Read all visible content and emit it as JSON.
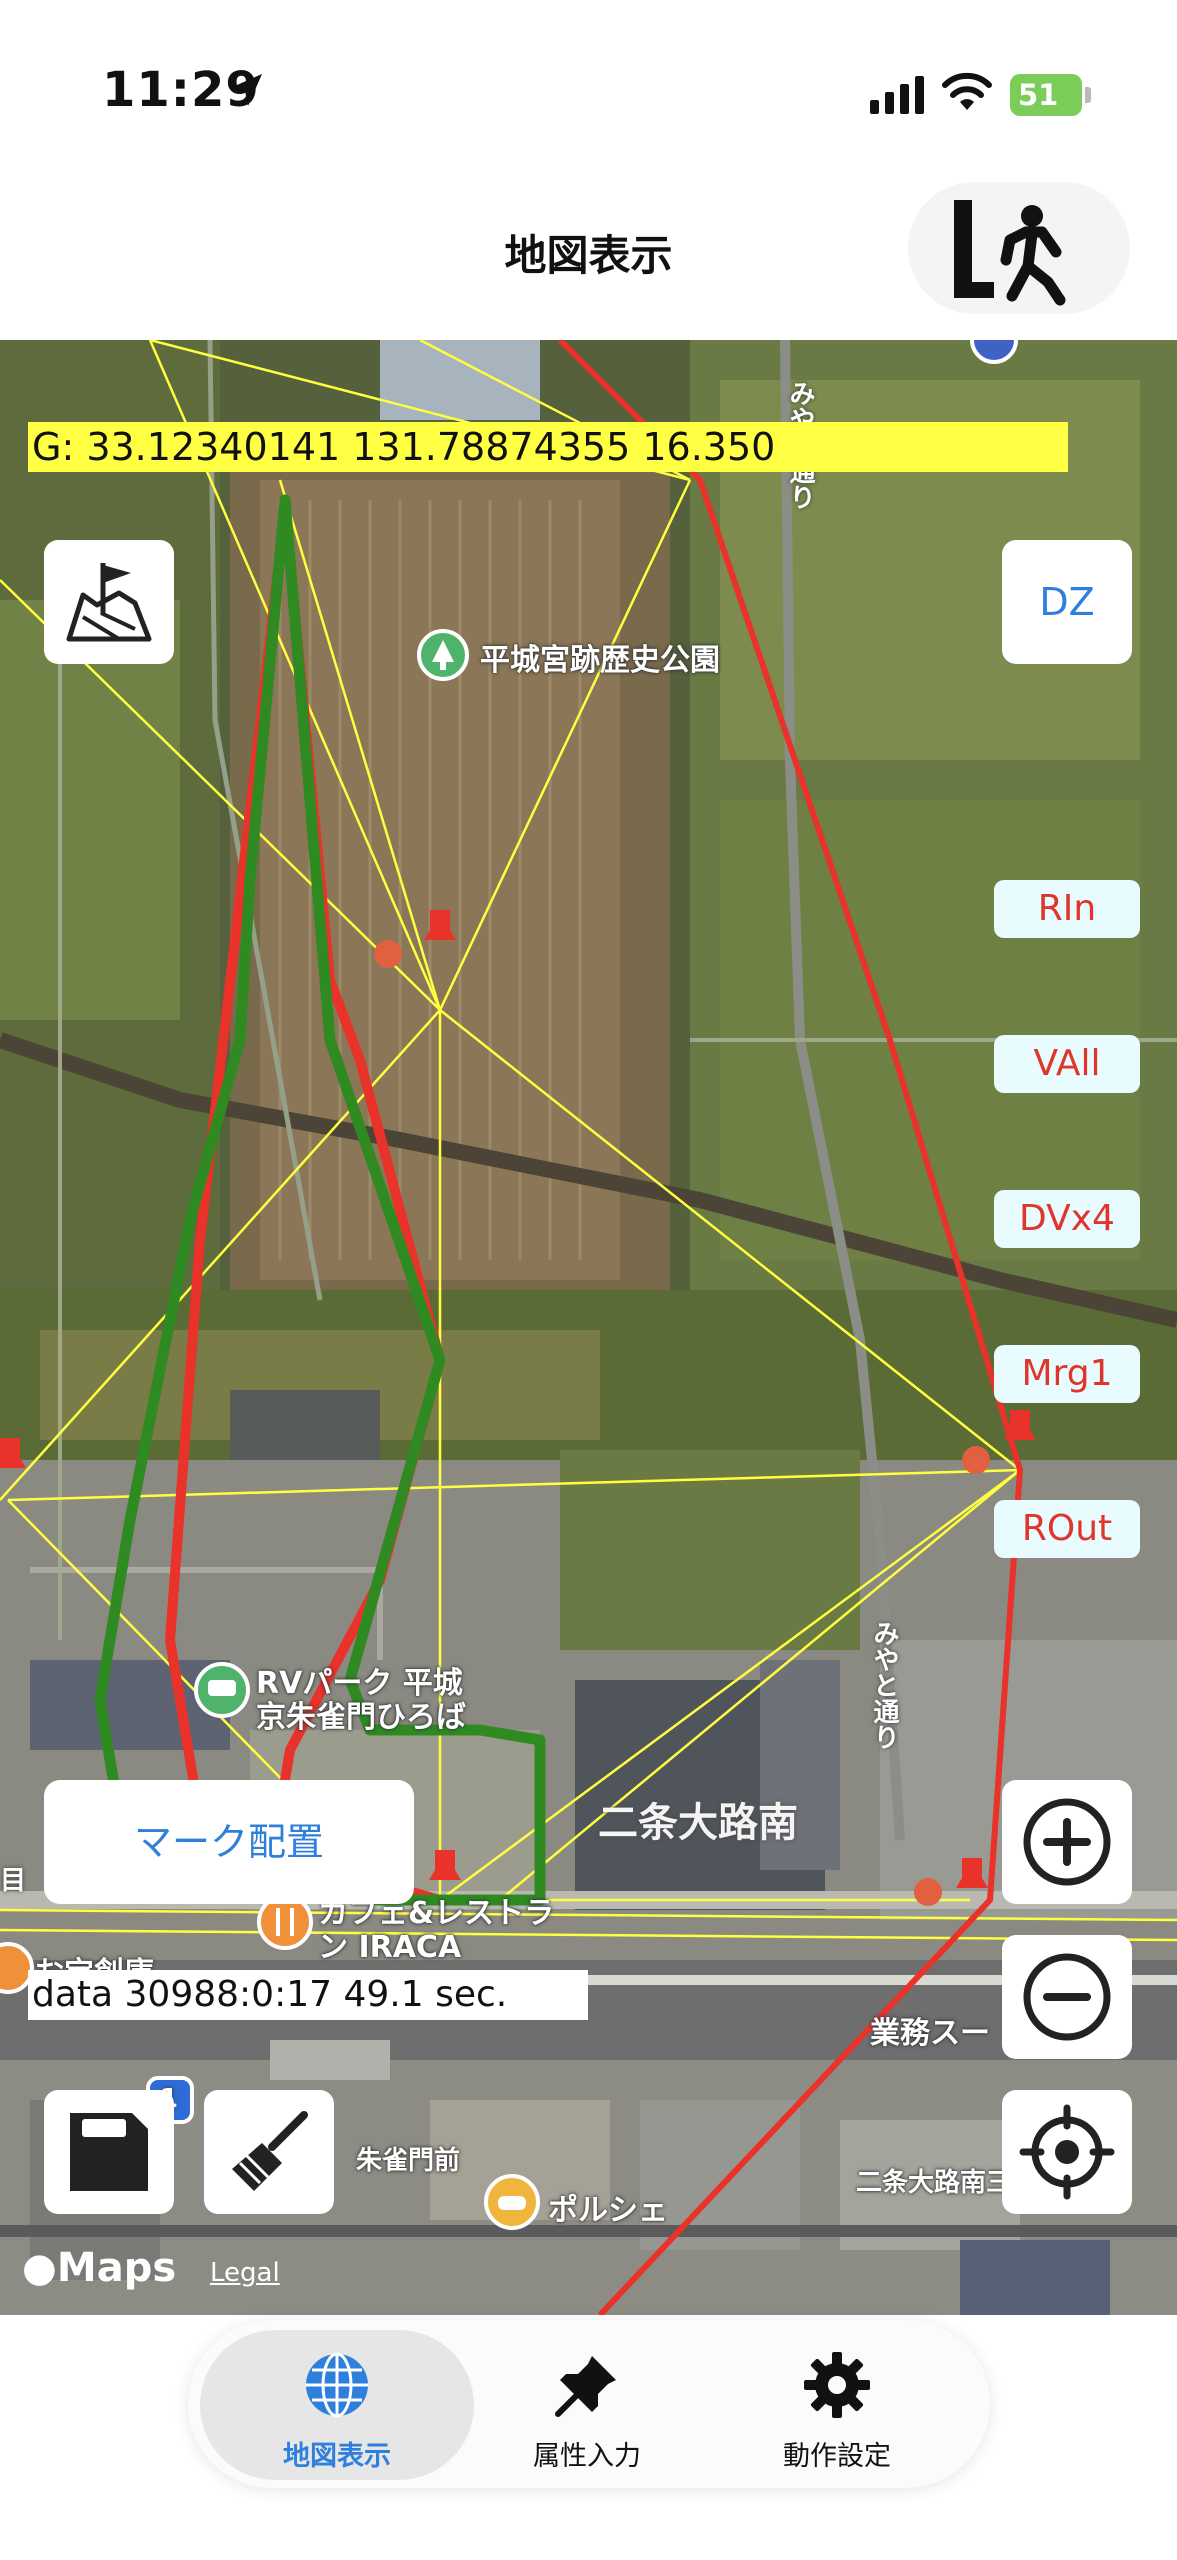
{
  "status_bar": {
    "time": "11:29",
    "battery": "51"
  },
  "nav": {
    "title": "地図表示"
  },
  "map": {
    "coordinate_readout": "G: 33.12340141 131.78874355 16.350",
    "data_readout": "data 30988:0:17 49.1 sec.",
    "side_buttons": {
      "dz": "DZ",
      "rin": "RIn",
      "vall": "VAll",
      "dvx4": "DVx4",
      "mrg1": "Mrg1",
      "rout": "ROut"
    },
    "mark_button": "マーク配置",
    "poi": {
      "park": "平城宮跡歴史公園",
      "rv_park_1": "RVパーク 平城",
      "rv_park_2": "京朱雀門ひろば",
      "cafe_1": "カフェ&レストラ",
      "cafe_2": "ン IRACA",
      "suzakumon": "朱雀門前",
      "porsche": "ポルシェ",
      "nijo_south": "二条大路南",
      "nijo_south_short": "二条大路南三",
      "business": "業務スー",
      "shop": "お宝創庫",
      "road_1": "みやと通り",
      "road_2": "みやと通り",
      "edge": "目",
      "route_num": "1"
    },
    "maps_logo": "Maps",
    "legal": "Legal",
    "colors": {
      "track_red": "#e8322a",
      "track_green": "#2f8a22",
      "grid_yellow": "#ffff40"
    }
  },
  "tabs": [
    {
      "label": "地図表示",
      "icon": "globe-icon",
      "active": true
    },
    {
      "label": "属性入力",
      "icon": "pushpin-icon",
      "active": false
    },
    {
      "label": "動作設定",
      "icon": "gear-icon",
      "active": false
    }
  ]
}
